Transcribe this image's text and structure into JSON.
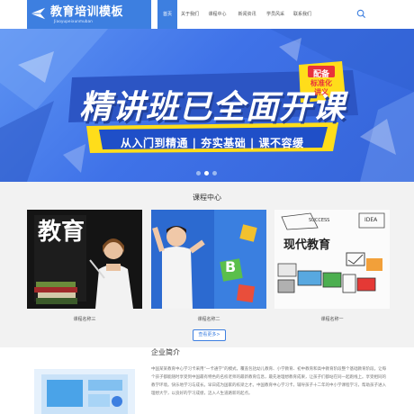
{
  "header": {
    "logo_title": "教育培训模板",
    "logo_subtitle": "Jiaoyupeixunmuban",
    "menu": [
      {
        "label": "首页",
        "active": true
      },
      {
        "label": "关于我们",
        "active": false
      },
      {
        "label": "课程中心",
        "active": false
      },
      {
        "label": "新闻资讯",
        "active": false
      },
      {
        "label": "学员风采",
        "active": false
      },
      {
        "label": "联系我们",
        "active": false
      }
    ],
    "search_icon": "search-icon",
    "accent_color": "#3d7fe0"
  },
  "banner": {
    "headline": "精讲班已全面开课",
    "slogan": "从入门到精通 | 夯实基础 | 课不容缓",
    "badge_line1": "配备",
    "badge_line2": "标准化",
    "badge_line3": "讲义",
    "slides_total": 3,
    "slide_active": 1
  },
  "courses": {
    "title": "课程中心",
    "items": [
      {
        "name": "课程名称三",
        "image_word": "教育",
        "image_word2": "育"
      },
      {
        "name": "课程名称二",
        "image_word": "B"
      },
      {
        "name": "课程名称一",
        "image_word": "现代教育",
        "doodles": [
          "SUCCESS",
          "IDEA"
        ]
      }
    ],
    "more_label": "查看更多>"
  },
  "about": {
    "title": "企业简介",
    "text": "中国某某教育中心学习卡采用“一卡通学”的模式，覆盖包括幼儿教育、小学教育、初中教育和高中教育阶段整个基础教育阶段。让每个孩子都能随时享受到中国最有特色的名校老师的最新教育信息，最先进理想教育成果，让孩子们都站在同一起跑线上。享受相同的教学环境。快乐地学习与成长。早日成为国家的栋梁之才。中国教育中心学习卡，辅导孩子十二年的中小学课程学习，帮助孩子进入理想大学，以良好的学习成绩，迈入人生道路新的起点。"
  }
}
